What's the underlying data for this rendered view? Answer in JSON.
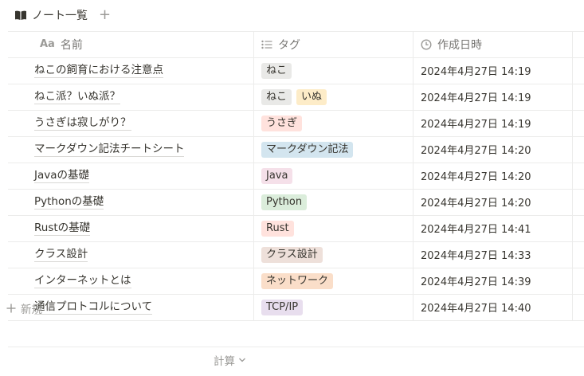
{
  "view": {
    "icon": "book-open-icon",
    "title": "ノート一覧",
    "add_label": "+"
  },
  "columns": [
    {
      "key": "name",
      "icon": "text-aa-icon",
      "icon_text": "Aa",
      "label": "名前"
    },
    {
      "key": "tags",
      "icon": "list-icon",
      "label": "タグ"
    },
    {
      "key": "created",
      "icon": "clock-icon",
      "label": "作成日時"
    }
  ],
  "tag_colors": {
    "ねこ": "#e9e9e7",
    "いぬ": "#fdecc8",
    "うさぎ": "#ffe2dd",
    "マークダウン記法": "#d3e5ef",
    "Java": "#f5e0e9",
    "Python": "#dbeddb",
    "Rust": "#ffe2dd",
    "クラス設計": "#eee0da",
    "ネットワーク": "#fadec9",
    "TCP/IP": "#e8deee"
  },
  "rows": [
    {
      "name": "ねこの飼育における注意点",
      "tags": [
        "ねこ"
      ],
      "created": "2024年4月27日 14:19"
    },
    {
      "name": "ねこ派？いぬ派？",
      "tags": [
        "ねこ",
        "いぬ"
      ],
      "created": "2024年4月27日 14:19"
    },
    {
      "name": "うさぎは寂しがり？",
      "tags": [
        "うさぎ"
      ],
      "created": "2024年4月27日 14:19"
    },
    {
      "name": "マークダウン記法チートシート",
      "tags": [
        "マークダウン記法"
      ],
      "created": "2024年4月27日 14:20"
    },
    {
      "name": "Javaの基礎",
      "tags": [
        "Java"
      ],
      "created": "2024年4月27日 14:20"
    },
    {
      "name": "Pythonの基礎",
      "tags": [
        "Python"
      ],
      "created": "2024年4月27日 14:20"
    },
    {
      "name": "Rustの基礎",
      "tags": [
        "Rust"
      ],
      "created": "2024年4月27日 14:41"
    },
    {
      "name": "クラス設計",
      "tags": [
        "クラス設計"
      ],
      "created": "2024年4月27日 14:33"
    },
    {
      "name": "インターネットとは",
      "tags": [
        "ネットワーク"
      ],
      "created": "2024年4月27日 14:39"
    },
    {
      "name": "通信プロトコルについて",
      "tags": [
        "TCP/IP"
      ],
      "created": "2024年4月27日 14:40"
    }
  ],
  "new_row_label": "新規",
  "calculate_label": "計算"
}
